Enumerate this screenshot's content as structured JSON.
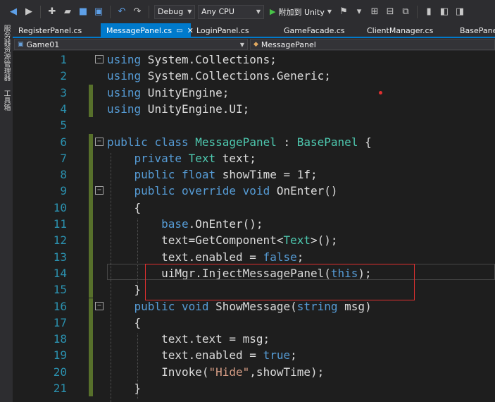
{
  "toolbar": {
    "config": "Debug",
    "platform": "Any CPU",
    "run_label": "附加到 Unity",
    "icons": [
      "back-icon",
      "forward-icon",
      "new-project-icon",
      "open-folder-icon",
      "save-icon",
      "save-all-icon",
      "undo-icon",
      "redo-icon"
    ]
  },
  "left_panel": {
    "server_explorer": "服务器资源管理器",
    "toolbox": "工具箱"
  },
  "tabs": [
    {
      "label": "RegisterPanel.cs"
    },
    {
      "label": "MessagePanel.cs",
      "active": true
    },
    {
      "label": "LoginPanel.cs"
    },
    {
      "label": "GameFacade.cs"
    },
    {
      "label": "ClientManager.cs"
    },
    {
      "label": "BasePanel.cs"
    }
  ],
  "navbar": {
    "project": "Game01",
    "type": "MessagePanel"
  },
  "editor": {
    "lines": [
      {
        "n": "1",
        "code": "using System.Collections;"
      },
      {
        "n": "2",
        "code": "using System.Collections.Generic;"
      },
      {
        "n": "3",
        "code": "using UnityEngine;"
      },
      {
        "n": "4",
        "code": "using UnityEngine.UI;"
      },
      {
        "n": "5",
        "code": ""
      },
      {
        "n": "6",
        "code": "public class MessagePanel : BasePanel {"
      },
      {
        "n": "7",
        "code": "    private Text text;"
      },
      {
        "n": "8",
        "code": "    public float showTime = 1f;"
      },
      {
        "n": "9",
        "code": "    public override void OnEnter()"
      },
      {
        "n": "10",
        "code": "    {"
      },
      {
        "n": "11",
        "code": "        base.OnEnter();"
      },
      {
        "n": "12",
        "code": "        text=GetComponent<Text>();"
      },
      {
        "n": "13",
        "code": "        text.enabled = false;"
      },
      {
        "n": "14",
        "code": "        uiMgr.InjectMessagePanel(this);"
      },
      {
        "n": "15",
        "code": "    }"
      },
      {
        "n": "16",
        "code": "    public void ShowMessage(string msg)"
      },
      {
        "n": "17",
        "code": "    {"
      },
      {
        "n": "18",
        "code": "        text.text = msg;"
      },
      {
        "n": "19",
        "code": "        text.enabled = true;"
      },
      {
        "n": "20",
        "code": "        Invoke(\"Hide\",showTime);"
      },
      {
        "n": "21",
        "code": "    }"
      }
    ]
  },
  "colors": {
    "keyword": "#569cd6",
    "type": "#4ec9b0",
    "string": "#d69d85",
    "line_number": "#2b91af",
    "accent": "#007acc",
    "highlight_box": "#e03030"
  }
}
